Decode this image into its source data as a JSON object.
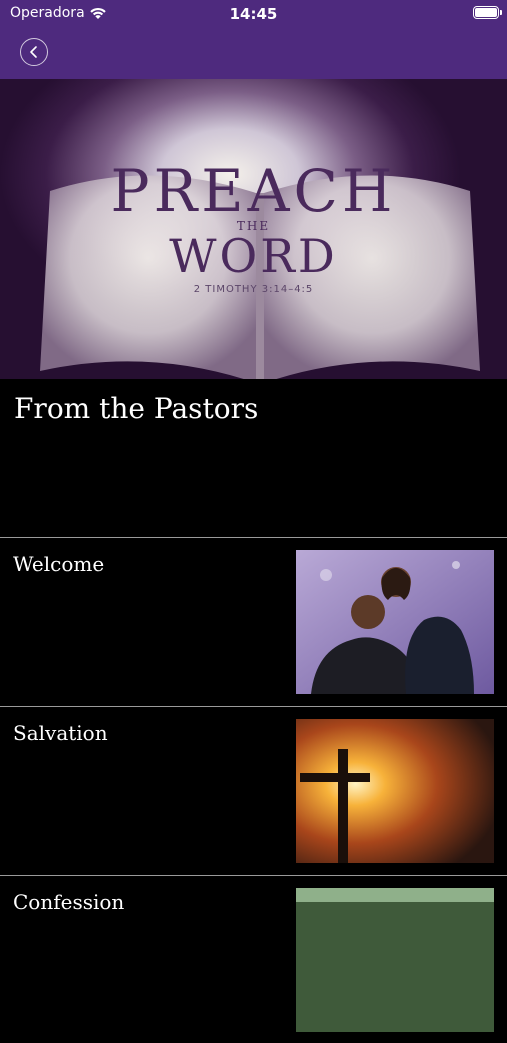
{
  "status_bar": {
    "carrier": "Operadora",
    "time": "14:45"
  },
  "nav": {
    "back_icon": "chevron-left-icon"
  },
  "hero": {
    "title_line1": "PREACH",
    "title_the": "THE",
    "title_line2": "WORD",
    "reference": "2 TIMOTHY 3:14–4:5"
  },
  "section": {
    "title": "From the Pastors"
  },
  "items": [
    {
      "label": "Welcome"
    },
    {
      "label": "Salvation"
    },
    {
      "label": "Confession"
    }
  ],
  "colors": {
    "nav_bar": "#4e2a7e",
    "background": "#000000",
    "divider": "#9a9a9a"
  }
}
